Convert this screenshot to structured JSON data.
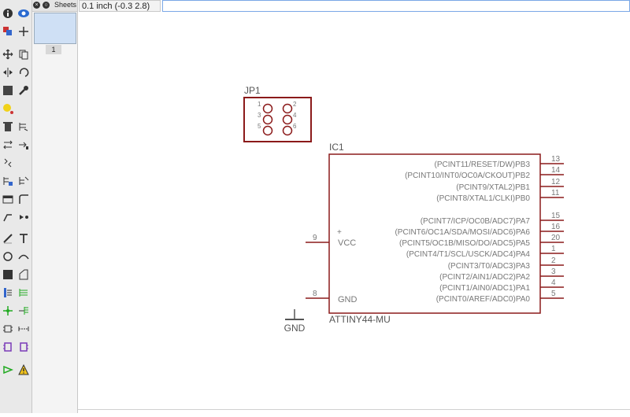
{
  "sheets_panel": {
    "title": "Sheets",
    "page_number": "1"
  },
  "coordinates": "0.1 inch (-0.3 2.8)",
  "command_line": {
    "value": ""
  },
  "schematic": {
    "connector": {
      "name": "JP1",
      "pin_numbers": [
        "1",
        "2",
        "3",
        "4",
        "5",
        "6"
      ]
    },
    "chip": {
      "name": "IC1",
      "value": "ATTINY44-MU",
      "right_pins": [
        {
          "label": "(PCINT11/RESET/DW)PB3",
          "number": "13"
        },
        {
          "label": "(PCINT10/INT0/OC0A/CKOUT)PB2",
          "number": "14"
        },
        {
          "label": "(PCINT9/XTAL2)PB1",
          "number": "12"
        },
        {
          "label": "(PCINT8/XTAL1/CLKI)PB0",
          "number": "11"
        },
        {
          "label": "(PCINT7/ICP/OC0B/ADC7)PA7",
          "number": "15"
        },
        {
          "label": "(PCINT6/OC1A/SDA/MOSI/ADC6)PA6",
          "number": "16"
        },
        {
          "label": "(PCINT5/OC1B/MISO/DO/ADC5)PA5",
          "number": "20"
        },
        {
          "label": "(PCINT4/T1/SCL/USCK/ADC4)PA4",
          "number": "1"
        },
        {
          "label": "(PCINT3/T0/ADC3)PA3",
          "number": "2"
        },
        {
          "label": "(PCINT2/AIN1/ADC2)PA2",
          "number": "3"
        },
        {
          "label": "(PCINT1/AIN0/ADC1)PA1",
          "number": "4"
        },
        {
          "label": "(PCINT0/AREF/ADC0)PA0",
          "number": "5"
        }
      ],
      "left_pins": [
        {
          "label": "VCC",
          "number": "9",
          "mark": "+"
        },
        {
          "label": "GND",
          "number": "8"
        }
      ]
    },
    "gnd_symbol": {
      "label": "GND"
    },
    "colors": {
      "part_outline": "#8b1a1a",
      "part_text": "#777777",
      "wire": "#8b1a1a",
      "dark": "#555555"
    }
  }
}
